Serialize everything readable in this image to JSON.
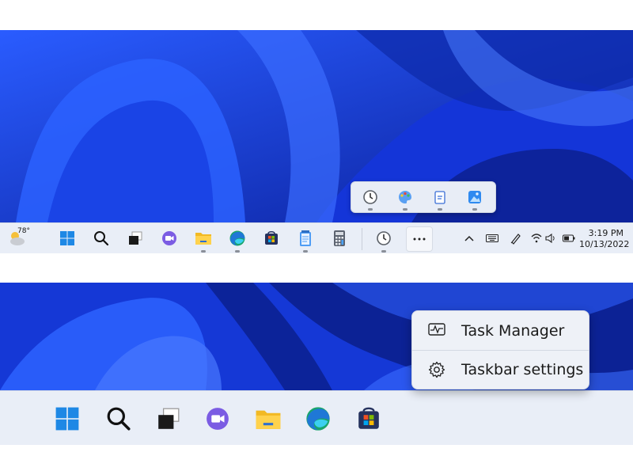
{
  "top_taskbar": {
    "weather": {
      "temperature": "78°",
      "icon": "weather-partly-sunny-icon"
    },
    "pinned_icons": [
      "start-icon",
      "search-icon",
      "task-view-icon",
      "teams-chat-icon",
      "file-explorer-icon",
      "edge-icon",
      "store-icon",
      "notepad-icon",
      "calculator-icon",
      "alarms-clock-icon",
      "more-overflow-icon"
    ],
    "overflow_icons": [
      "alarms-clock-icon",
      "paint-icon",
      "notepad-alt-icon",
      "photos-icon"
    ],
    "tray": {
      "time": "3:19 PM",
      "date": "10/13/2022"
    }
  },
  "bottom_taskbar": {
    "pinned_icons": [
      "start-icon",
      "search-icon",
      "task-view-icon",
      "teams-chat-icon",
      "file-explorer-icon",
      "edge-icon",
      "store-icon"
    ]
  },
  "context_menu": {
    "items": [
      {
        "label": "Task Manager",
        "icon": "task-manager-icon"
      },
      {
        "label": "Taskbar settings",
        "icon": "gear-icon"
      }
    ]
  },
  "colors": {
    "wallpaper": "#1a3fe0",
    "taskbar": "#e9eef7",
    "accent": "#0067c0"
  }
}
